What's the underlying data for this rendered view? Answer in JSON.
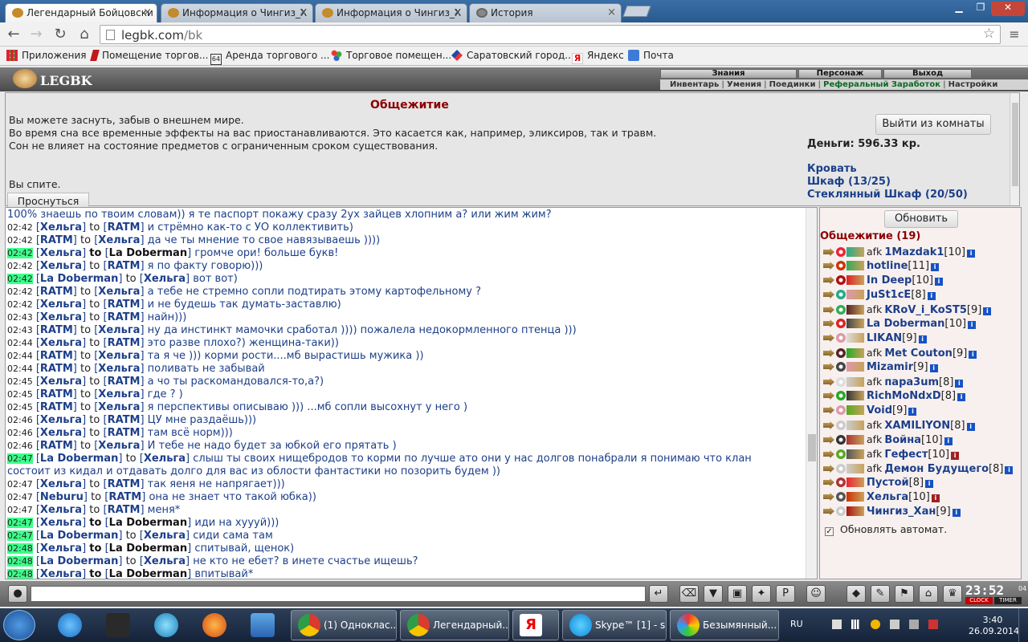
{
  "browser": {
    "tabs": [
      {
        "title": "Легендарный Бойцовски",
        "active": true
      },
      {
        "title": "Информация о Чингиз_Х",
        "active": false
      },
      {
        "title": "Информация о Чингиз_Х",
        "active": false
      },
      {
        "title": "История",
        "active": false
      }
    ],
    "url_host": "legbk.com",
    "url_path": "/bk",
    "bookmarks": [
      {
        "label": "Приложения",
        "icon": "apps-grid-icon"
      },
      {
        "label": "Помещение торгов...",
        "icon": "bookmark-red-icon"
      },
      {
        "label": "Аренда торгового ...",
        "icon": "bookmark-64-icon"
      },
      {
        "label": "Торговое помещен...",
        "icon": "bookmark-colorful-icon"
      },
      {
        "label": "Саратовский город...",
        "icon": "bookmark-blue-icon"
      },
      {
        "label": "Яндекс",
        "icon": "yandex-icon"
      },
      {
        "label": "Почта",
        "icon": "mail-icon"
      }
    ]
  },
  "game": {
    "logo": "LEGBK",
    "top_tabs": [
      "Знания",
      "Персонаж",
      "Выход"
    ],
    "subnav": [
      "Инвентарь",
      "Умения",
      "Поединки",
      "Реферальный Заработок",
      "Настройки"
    ],
    "room": {
      "title": "Общежитие",
      "info": [
        "Вы можете заснуть, забыв о внешнем мире.",
        "Во время сна все временные эффекты на вас приостанавливаются. Это касается как, например, эликсиров, так и травм.",
        "Сон не влияет на состояние предметов с ограниченным сроком существования."
      ],
      "status": "Вы спите.",
      "wake_label": "Проснуться",
      "leave_label": "Выйти из комнаты",
      "money": "Деньги: 596.33 кр.",
      "furniture": [
        "Кровать",
        "Шкаф (13/25)",
        "Стеклянный Шкаф (20/50)"
      ]
    },
    "chat": [
      {
        "time": "",
        "hl": false,
        "from": "",
        "to": "",
        "priv": false,
        "text": "100% знаешь по твоим словам)) я те паспорт покажу сразу 2ух зайцев хлопним а? или жим жим?"
      },
      {
        "time": "02:42",
        "hl": false,
        "from": "Хельга",
        "to": "RATM",
        "priv": false,
        "text": "и стрёмно как-то с УО коллективить)"
      },
      {
        "time": "02:42",
        "hl": false,
        "from": "RATM",
        "to": "Хельга",
        "priv": false,
        "text": "да че ты мнение то свое навязываешь ))))"
      },
      {
        "time": "02:42",
        "hl": true,
        "from": "Хельга",
        "to": "La Doberman",
        "priv": true,
        "text": "громче ори! больше букв!"
      },
      {
        "time": "02:42",
        "hl": false,
        "from": "Хельга",
        "to": "RATM",
        "priv": false,
        "text": "я по факту говорю)))"
      },
      {
        "time": "02:42",
        "hl": true,
        "from": "La Doberman",
        "to": "Хельга",
        "priv": false,
        "text": "вот вот)"
      },
      {
        "time": "02:42",
        "hl": false,
        "from": "RATM",
        "to": "Хельга",
        "priv": false,
        "text": "а тебе не стремно сопли подтирать этому картофельному ?"
      },
      {
        "time": "02:42",
        "hl": false,
        "from": "Хельга",
        "to": "RATM",
        "priv": false,
        "text": "и не будешь так думать-заставлю)"
      },
      {
        "time": "02:43",
        "hl": false,
        "from": "Хельга",
        "to": "RATM",
        "priv": false,
        "text": "найн)))"
      },
      {
        "time": "02:43",
        "hl": false,
        "from": "RATM",
        "to": "Хельга",
        "priv": false,
        "text": "ну да инстинкт мамочки сработал )))) пожалела недокормленного птенца )))"
      },
      {
        "time": "02:44",
        "hl": false,
        "from": "Хельга",
        "to": "RATM",
        "priv": false,
        "text": "это разве плохо?) женщина-таки))"
      },
      {
        "time": "02:44",
        "hl": false,
        "from": "RATM",
        "to": "Хельга",
        "priv": false,
        "text": "та я че ))) корми рости....мб вырастишь мужика ))"
      },
      {
        "time": "02:44",
        "hl": false,
        "from": "RATM",
        "to": "Хельга",
        "priv": false,
        "text": "поливать не забывай"
      },
      {
        "time": "02:45",
        "hl": false,
        "from": "Хельга",
        "to": "RATM",
        "priv": false,
        "text": "а чо ты раскомандовался-то,а?)"
      },
      {
        "time": "02:45",
        "hl": false,
        "from": "RATM",
        "to": "Хельга",
        "priv": false,
        "text": "где ? )"
      },
      {
        "time": "02:45",
        "hl": false,
        "from": "RATM",
        "to": "Хельга",
        "priv": false,
        "text": "я перспективы описываю ))) ...мб сопли высохнут у него )"
      },
      {
        "time": "02:46",
        "hl": false,
        "from": "Хельга",
        "to": "RATM",
        "priv": false,
        "text": "ЦУ мне раздаёшь)))"
      },
      {
        "time": "02:46",
        "hl": false,
        "from": "Хельга",
        "to": "RATM",
        "priv": false,
        "text": "там всё норм)))"
      },
      {
        "time": "02:46",
        "hl": false,
        "from": "RATM",
        "to": "Хельга",
        "priv": false,
        "text": "И тебе не надо будет за юбкой его прятать )"
      },
      {
        "time": "02:47",
        "hl": true,
        "from": "La Doberman",
        "to": "Хельга",
        "priv": false,
        "text": "слыш ты своих нищебродов то корми по лучше ато они у нас долгов понабрали я понимаю что клан"
      },
      {
        "time": "",
        "hl": false,
        "from": "",
        "to": "",
        "priv": false,
        "text": "состоит из кидал и отдавать долго для вас из облости фантастики но позорить будем ))"
      },
      {
        "time": "02:47",
        "hl": false,
        "from": "Хельга",
        "to": "RATM",
        "priv": false,
        "text": "так яеня не напрягает)))"
      },
      {
        "time": "02:47",
        "hl": false,
        "from": "Neburu",
        "to": "RATM",
        "priv": false,
        "text": "она не знает что такой юбка))"
      },
      {
        "time": "02:47",
        "hl": false,
        "from": "Хельга",
        "to": "RATM",
        "priv": false,
        "text": "меня*"
      },
      {
        "time": "02:47",
        "hl": true,
        "from": "Хельга",
        "to": "La Doberman",
        "priv": true,
        "text": "иди на хуууй)))"
      },
      {
        "time": "02:47",
        "hl": true,
        "from": "La Doberman",
        "to": "Хельга",
        "priv": false,
        "text": "сиди сама там"
      },
      {
        "time": "02:48",
        "hl": true,
        "from": "Хельга",
        "to": "La Doberman",
        "priv": true,
        "text": "спитывай, щенок)"
      },
      {
        "time": "02:48",
        "hl": true,
        "from": "La Doberman",
        "to": "Хельга",
        "priv": false,
        "text": "не кто не ебет? в инете счастье ищешь?"
      },
      {
        "time": "02:48",
        "hl": true,
        "from": "Хельга",
        "to": "La Doberman",
        "priv": true,
        "text": "впитывай*"
      }
    ],
    "to_word": "to",
    "userlist": {
      "refresh_label": "Обновить",
      "room_count": "Общежитие (19)",
      "users": [
        {
          "afk": true,
          "name": "1Mazdak1",
          "level": "[10]",
          "red": false
        },
        {
          "afk": false,
          "name": "hotline",
          "level": "[11]",
          "red": false
        },
        {
          "afk": false,
          "name": "In Deep",
          "level": "[10]",
          "red": false
        },
        {
          "afk": false,
          "name": "JuSt1cE",
          "level": "[8]",
          "red": false
        },
        {
          "afk": true,
          "name": "KRoV_i_KoST5",
          "level": "[9]",
          "red": false
        },
        {
          "afk": false,
          "name": "La Doberman",
          "level": "[10]",
          "red": false
        },
        {
          "afk": false,
          "name": "LIKAN",
          "level": "[9]",
          "red": false
        },
        {
          "afk": true,
          "name": "Met Couton",
          "level": "[9]",
          "red": false
        },
        {
          "afk": false,
          "name": "Mizamir",
          "level": "[9]",
          "red": false
        },
        {
          "afk": true,
          "name": "пара3um",
          "level": "[8]",
          "red": false
        },
        {
          "afk": false,
          "name": "RichMoNdxD",
          "level": "[8]",
          "red": false
        },
        {
          "afk": false,
          "name": "Void",
          "level": "[9]",
          "red": false
        },
        {
          "afk": true,
          "name": "XAMILIYON",
          "level": "[8]",
          "red": false
        },
        {
          "afk": true,
          "name": "Война",
          "level": "[10]",
          "red": false
        },
        {
          "afk": true,
          "name": "Гефест",
          "level": "[10]",
          "red": true
        },
        {
          "afk": true,
          "name": "Демон Будущего",
          "level": "[8]",
          "red": false
        },
        {
          "afk": false,
          "name": "Пустой",
          "level": "[8]",
          "red": false
        },
        {
          "afk": false,
          "name": "Хельга",
          "level": "[10]",
          "red": true
        },
        {
          "afk": false,
          "name": "Чингиз_Хан",
          "level": "[9]",
          "red": false
        }
      ],
      "afk_word": "afk",
      "auto_refresh_label": "Обновлять автомат."
    },
    "clock": {
      "time": "23:52",
      "sec": "04",
      "label1": "CLOCK",
      "label2": "TIMER"
    }
  },
  "taskbar": {
    "tasks": [
      {
        "title": "(1) Одноклас...",
        "icon": "chrome-icon"
      },
      {
        "title": "Легендарный...",
        "icon": "chrome-icon"
      },
      {
        "title": "",
        "icon": "yandex-browser-icon"
      },
      {
        "title": "Skype™ [1] - s...",
        "icon": "skype-icon"
      },
      {
        "title": "Безымянный...",
        "icon": "paint-icon"
      }
    ],
    "lang": "RU",
    "time": "3:40",
    "date": "26.09.2014"
  }
}
